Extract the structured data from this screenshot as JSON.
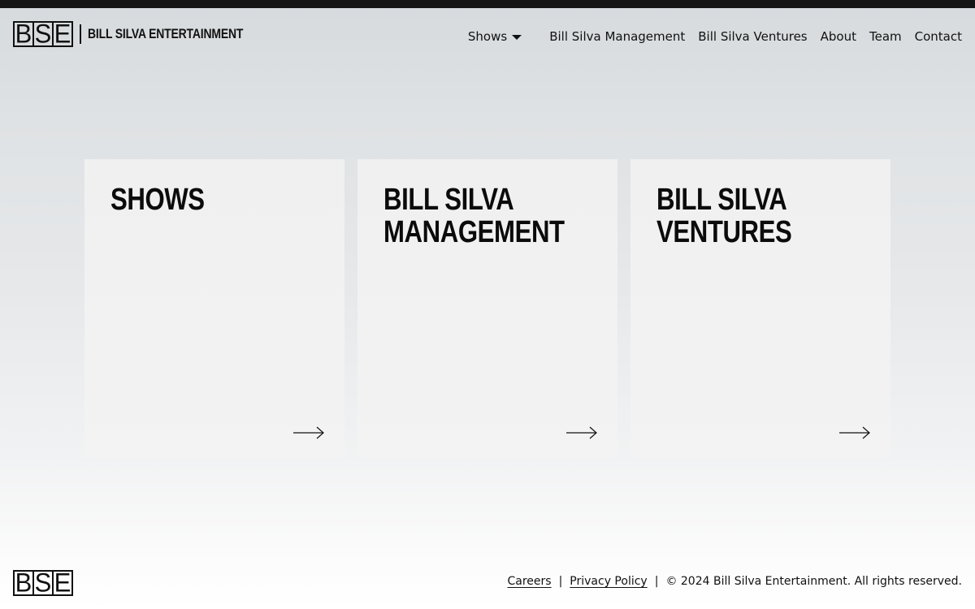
{
  "logo": {
    "letters": [
      "B",
      "S",
      "E"
    ],
    "wordmark": "BILL SILVA ENTERTAINMENT"
  },
  "nav": {
    "shows": "Shows",
    "management": "Bill Silva Management",
    "ventures": "Bill Silva Ventures",
    "about": "About",
    "team": "Team",
    "contact": "Contact"
  },
  "cards": [
    {
      "title_line1": "SHOWS",
      "title_line2": "",
      "arrow_icon": "arrow-right-icon"
    },
    {
      "title_line1": "BILL SILVA",
      "title_line2": "MANAGEMENT",
      "arrow_icon": "arrow-right-icon"
    },
    {
      "title_line1": "BILL SILVA",
      "title_line2": "VENTURES",
      "arrow_icon": "arrow-right-icon"
    }
  ],
  "footer": {
    "careers": "Careers",
    "separator": "|",
    "privacy": "Privacy Policy",
    "copyright": "© 2024 Bill Silva Entertainment. All rights reserved."
  },
  "colors": {
    "top_bar": "#151515",
    "text": "#111111",
    "card_bg": "#f1f1f1"
  }
}
